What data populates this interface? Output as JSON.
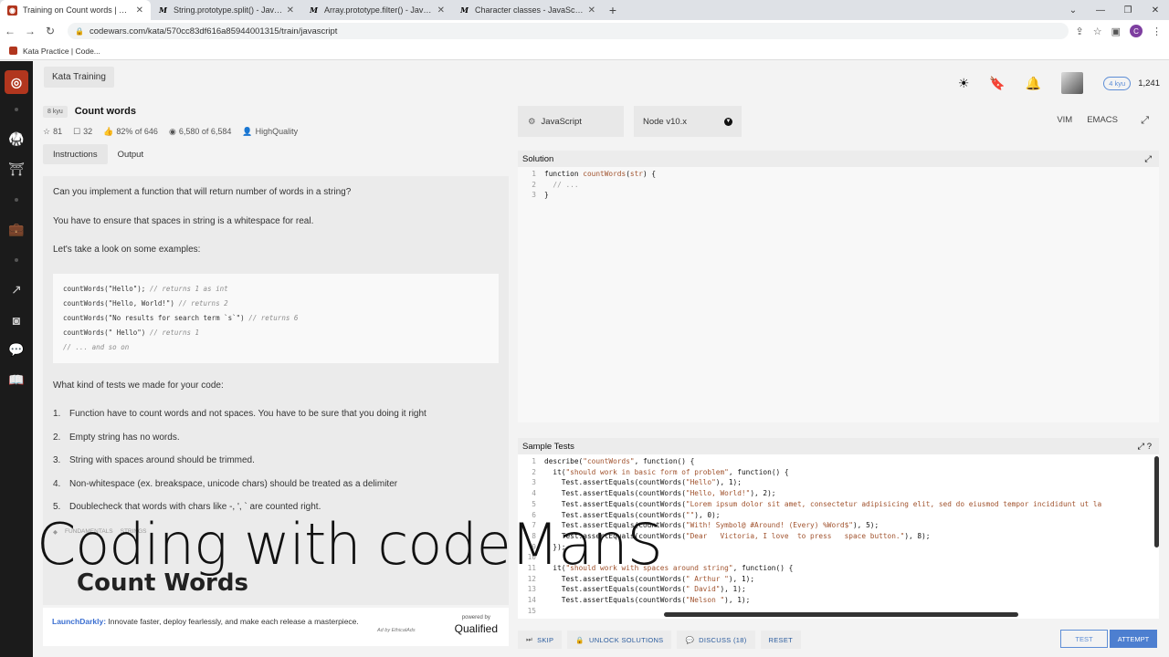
{
  "browser": {
    "tabs": [
      {
        "title": "Training on Count words | Codewars",
        "favicon": "cw",
        "active": true
      },
      {
        "title": "String.prototype.split() - JavaScript",
        "favicon": "mdn",
        "active": false
      },
      {
        "title": "Array.prototype.filter() - JavaScript",
        "favicon": "mdn",
        "active": false
      },
      {
        "title": "Character classes - JavaScript | M",
        "favicon": "mdn",
        "active": false
      }
    ],
    "url": "codewars.com/kata/570cc83df616a85944001315/train/javascript",
    "bookmark": "Kata Practice | Code...",
    "profile_initial": "C"
  },
  "topbar": {
    "kata_training": "Kata Training",
    "kyu_badge": "4 kyu",
    "honor": "1,241"
  },
  "kata": {
    "kyu": "8 kyu",
    "name": "Count words",
    "stats": {
      "stars": "81",
      "collections": "32",
      "satisfaction": "82% of 646",
      "completed": "6,580 of 6,584",
      "author": "HighQuality"
    },
    "tabs": {
      "instructions": "Instructions",
      "output": "Output"
    },
    "description": {
      "p1": "Can you implement a function that will return number of words in a string?",
      "p2": "You have to ensure that spaces in string is a whitespace for real.",
      "p3": "Let's take a look on some examples:",
      "code_lines": [
        {
          "code": "countWords(\"Hello\"); ",
          "comment": "// returns 1 as int"
        },
        {
          "code": "countWords(\"Hello, World!\") ",
          "comment": "// returns 2"
        },
        {
          "code": "countWords(\"No results for search term `s`\") ",
          "comment": "// returns 6"
        },
        {
          "code": "countWords(\" Hello\") ",
          "comment": "// returns 1"
        },
        {
          "code": "",
          "comment": "// ... and so on"
        }
      ],
      "p4": "What kind of tests we made for your code:",
      "list": [
        {
          "n": "1.",
          "text": "Function have to count words and not spaces. You have to be sure that you doing it right"
        },
        {
          "n": "2.",
          "text": "Empty string has no words."
        },
        {
          "n": "3.",
          "text": "String with spaces around should be trimmed."
        },
        {
          "n": "4.",
          "text": "Non-whitespace (ex. breakspace, unicode chars) should be treated as a delimiter"
        },
        {
          "n": "5.",
          "text": "Doublecheck that words with chars like -, ', ` are counted right."
        }
      ],
      "tags": [
        "FUNDAMENTALS",
        "STRINGS"
      ]
    }
  },
  "ad": {
    "brand": "LaunchDarkly:",
    "text": " Innovate faster, deploy fearlessly, and make each release a masterpiece.",
    "by": "Ad by EthicalAds",
    "powered": "powered by",
    "qualified": "Qualified"
  },
  "overlay": {
    "title": "Coding with codeManS",
    "subtitle": "Count Words"
  },
  "editor": {
    "language": "JavaScript",
    "runtime": "Node v10.x",
    "vim": "VIM",
    "emacs": "EMACS",
    "solution_label": "Solution",
    "solution_lines": [
      "1",
      "2",
      "3"
    ],
    "tests_label": "Sample Tests",
    "test_line_numbers": [
      "1",
      "2",
      "3",
      "4",
      "5",
      "6",
      "7",
      "8",
      "9",
      "10",
      "11",
      "12",
      "13",
      "14",
      "15"
    ]
  },
  "actions": {
    "skip": "SKIP",
    "unlock": "UNLOCK SOLUTIONS",
    "discuss": "DISCUSS (18)",
    "reset": "RESET",
    "test": "TEST",
    "attempt": "ATTEMPT"
  }
}
